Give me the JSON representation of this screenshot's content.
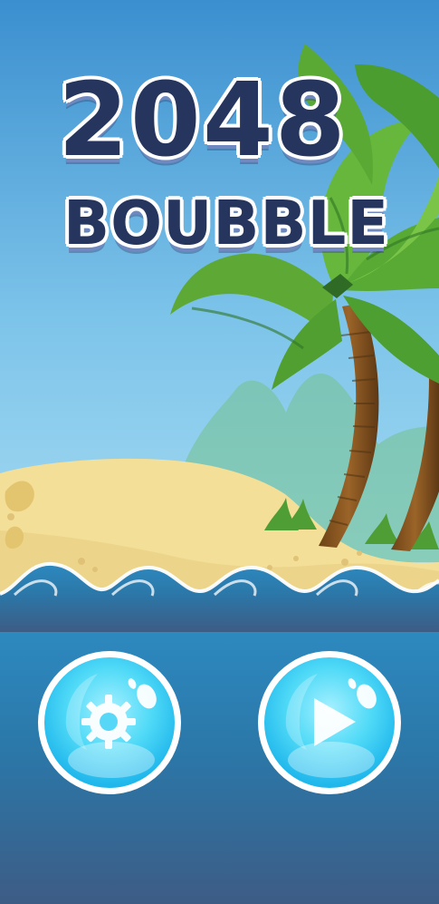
{
  "title": {
    "number": "2048",
    "word": "BOUBBLE"
  },
  "menu": {
    "settings": {
      "icon": "gear-icon"
    },
    "play": {
      "icon": "play-icon"
    }
  },
  "colors": {
    "title_text": "#25355d",
    "title_outline": "#ffffff",
    "bubble": "#42d4f5",
    "bubble_edge": "#ffffff",
    "sky_top": "#3b8fcf",
    "sand": "#f4df97",
    "sea": "#2d89bf"
  }
}
